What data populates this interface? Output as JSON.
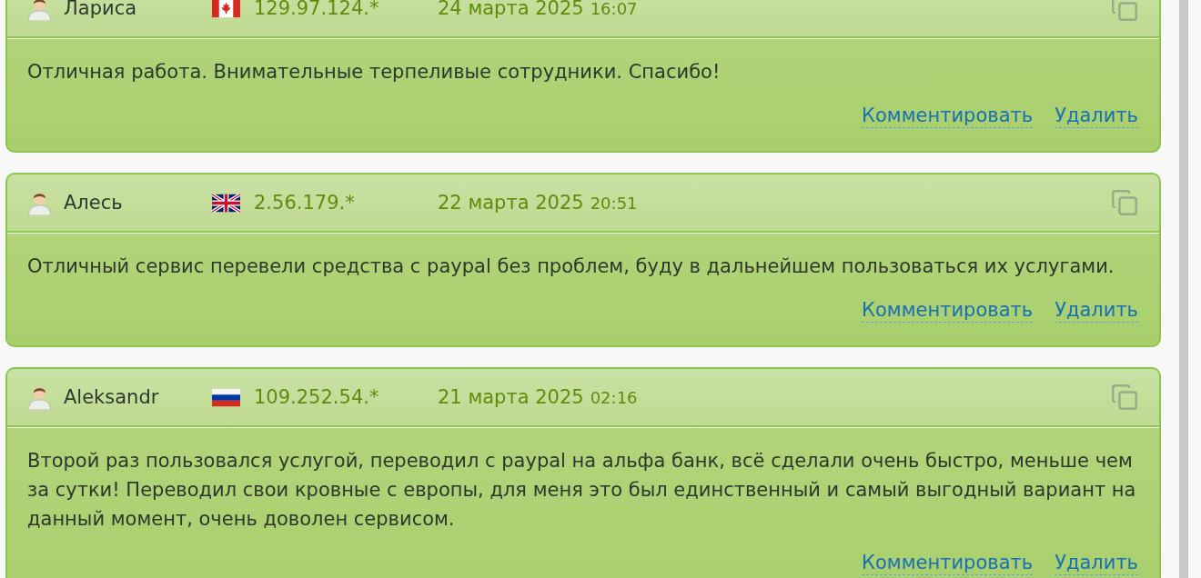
{
  "reviews": [
    {
      "author": "Лариса",
      "flag": {
        "kind": "canada"
      },
      "ip": "129.97.124.*",
      "date": "24 марта 2025",
      "time": "16:07",
      "text": "Отличная работа. Внимательные терпеливые сотрудники. Спасибо!",
      "actions": [
        "Комментировать",
        "Удалить"
      ]
    },
    {
      "author": "Алесь",
      "flag": {
        "kind": "uk"
      },
      "ip": "2.56.179.*",
      "date": "22 марта 2025",
      "time": "20:51",
      "text": "Отличный сервис перевели средства с paypal без проблем, буду в дальнейшем пользоваться их услугами.",
      "actions": [
        "Комментировать",
        "Удалить"
      ]
    },
    {
      "author": "Aleksandr",
      "flag": {
        "kind": "russia"
      },
      "ip": "109.252.54.*",
      "date": "21 марта 2025",
      "time": "02:16",
      "text": "Второй раз пользовался услугой, переводил с paypal на альфа банк, всё сделали очень быстро, меньше чем за сутки! Переводил свои кровные с европы, для меня это был единственный и самый выгодный вариант на данный момент, очень доволен сервисом.",
      "actions": [
        "Комментировать",
        "Удалить"
      ]
    }
  ]
}
